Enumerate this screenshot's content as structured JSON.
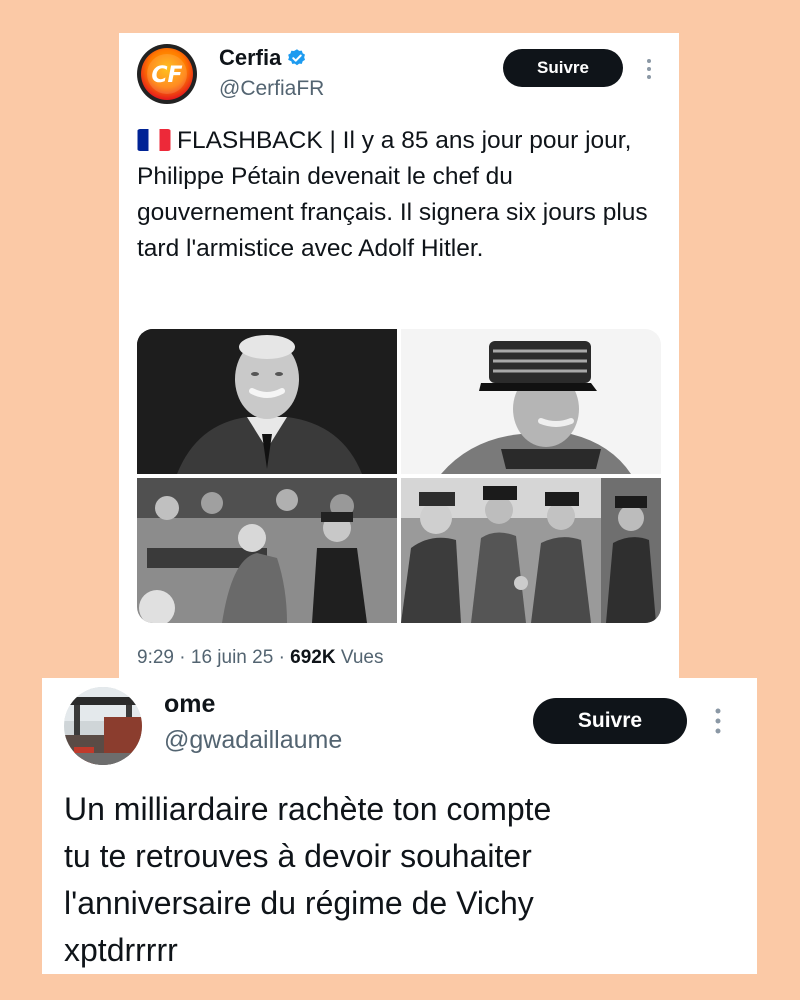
{
  "tweet": {
    "display_name": "Cerfia",
    "handle": "@CerfiaFR",
    "follow_label": "Suivre",
    "avatar_letters": "CF",
    "text": "FLASHBACK | Il y a 85 ans jour pour jour, Philippe Pétain devenait le chef du gouvernement français. Il signera six jours plus tard l'armistice avec Adolf Hitler.",
    "time": "9:29",
    "date": "16 juin 25",
    "separator": "·",
    "views_count": "692K",
    "views_label": "Vues",
    "colors": {
      "verified": "#1d9bf0",
      "avatar_outer": "#ee1c24",
      "avatar_inner": "#f7a600",
      "flag_blue": "#002395",
      "flag_red": "#ed2939"
    },
    "icons": [
      "verified-badge-icon",
      "more-options-icon",
      "flag-france-icon"
    ]
  },
  "reply": {
    "display_name": "ome",
    "handle": "@gwadaillaume",
    "follow_label": "Suivre",
    "text_lines": [
      "Un milliardaire rachète ton compte",
      "tu te retrouves à devoir souhaiter",
      "l'anniversaire du régime de Vichy",
      "xptdrrrrr"
    ],
    "icons": [
      "more-options-icon"
    ]
  }
}
